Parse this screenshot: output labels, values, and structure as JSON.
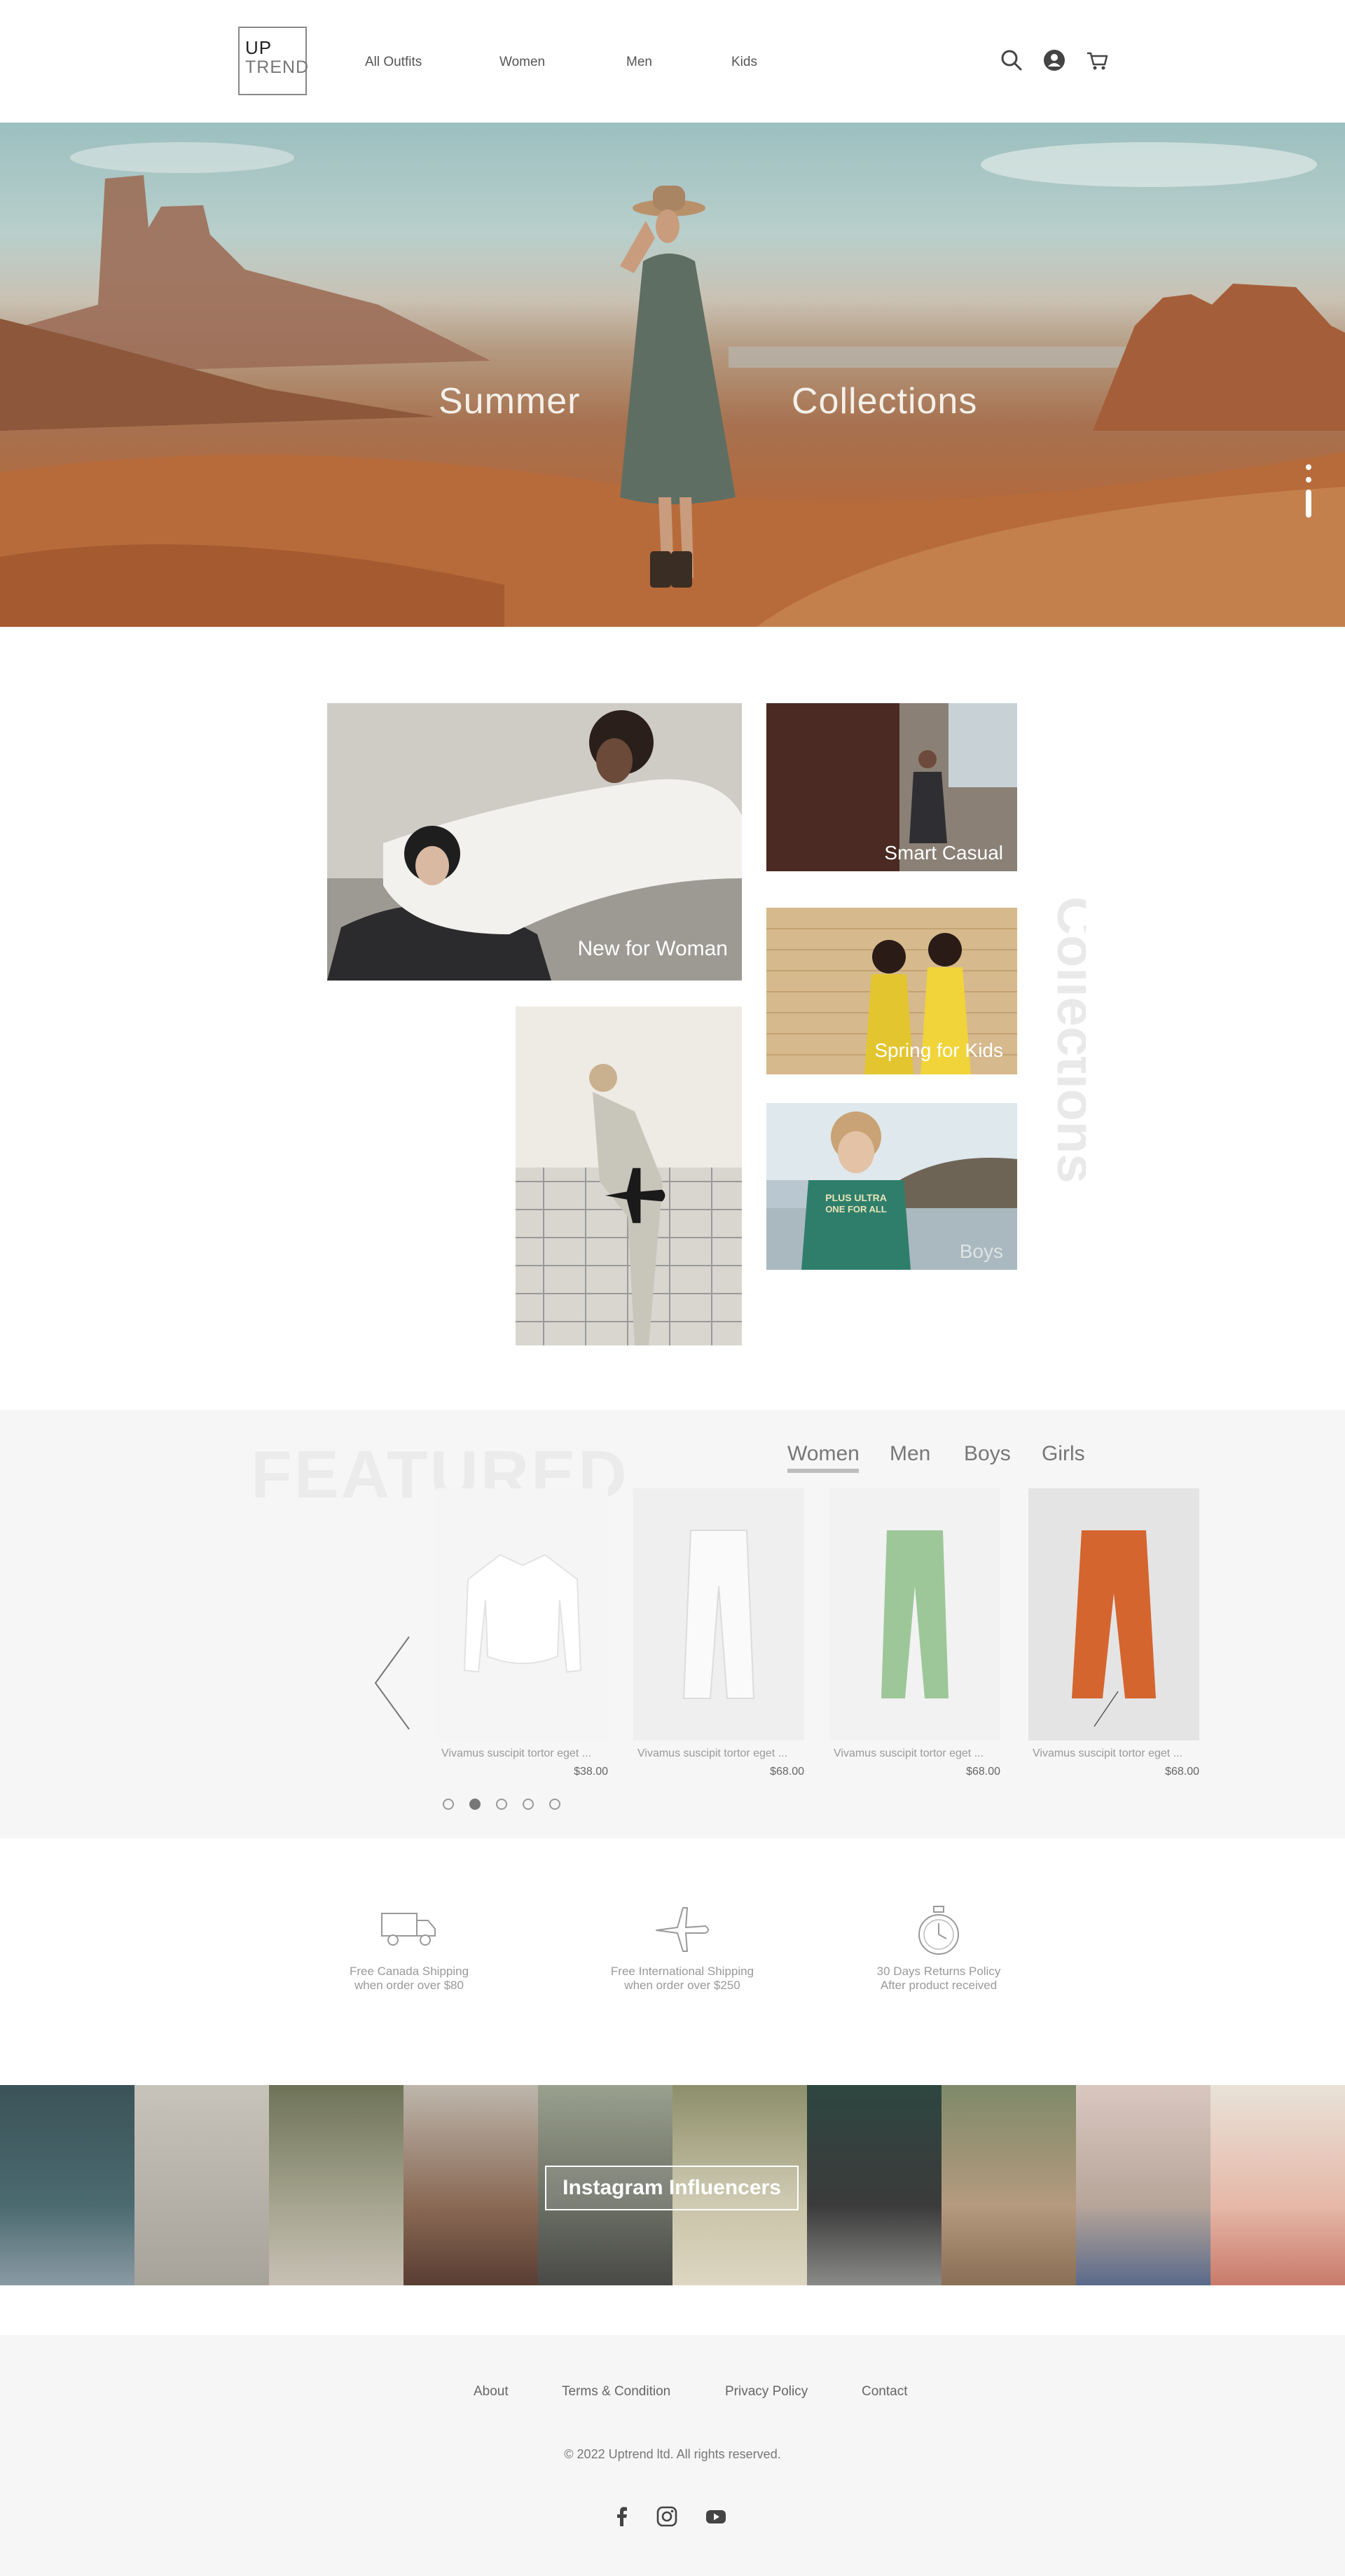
{
  "brand": {
    "line1": "UP",
    "line2": "TREND"
  },
  "nav": [
    {
      "label": "All Outfits"
    },
    {
      "label": "Women"
    },
    {
      "label": "Men"
    },
    {
      "label": "Kids"
    }
  ],
  "hero": {
    "left_word": "Summer",
    "right_word": "Collections"
  },
  "collections": {
    "side_heading": "Collections",
    "tiles": [
      {
        "label": "New for Woman"
      },
      {
        "label": "Smart Casual"
      },
      {
        "label": "Spring for Kids"
      },
      {
        "label": "Boys"
      },
      {
        "label": ""
      }
    ]
  },
  "featured": {
    "heading": "FEATURED",
    "tabs": [
      {
        "label": "Women",
        "active": true
      },
      {
        "label": "Men"
      },
      {
        "label": "Boys"
      },
      {
        "label": "Girls"
      }
    ],
    "products": [
      {
        "name": "Vivamus suscipit tortor eget ...",
        "price": "$38.00",
        "color": "#f7f7f7"
      },
      {
        "name": "Vivamus suscipit tortor eget ...",
        "price": "$68.00",
        "color": "#f1f1f1"
      },
      {
        "name": "Vivamus suscipit tortor eget ...",
        "price": "$68.00",
        "color": "#9dc799"
      },
      {
        "name": "Vivamus suscipit tortor eget ...",
        "price": "$68.00",
        "color": "#d5652f"
      }
    ],
    "pager": {
      "count": 5,
      "active": 2
    }
  },
  "shipping": [
    {
      "icon": "truck-icon",
      "line1": "Free Canada Shipping",
      "line2": "when order over $80"
    },
    {
      "icon": "airplane-icon",
      "line1": "Free International Shipping",
      "line2": "when order over $250"
    },
    {
      "icon": "stopwatch-icon",
      "line1": "30 Days Returns Policy",
      "line2": "After product received"
    }
  ],
  "instagram": {
    "button": "Instagram Influencers"
  },
  "footer": {
    "links": [
      {
        "label": "About"
      },
      {
        "label": "Terms & Condition"
      },
      {
        "label": "Privacy Policy"
      },
      {
        "label": "Contact"
      }
    ],
    "copyright": "© 2022 Uptrend ltd. All rights reserved.",
    "social": [
      "facebook-icon",
      "instagram-icon",
      "youtube-icon"
    ]
  },
  "colors": {
    "accent": "#bdbdbd",
    "featured_bg": "#f6f6f6",
    "footer_bg": "#f6f6f6"
  }
}
